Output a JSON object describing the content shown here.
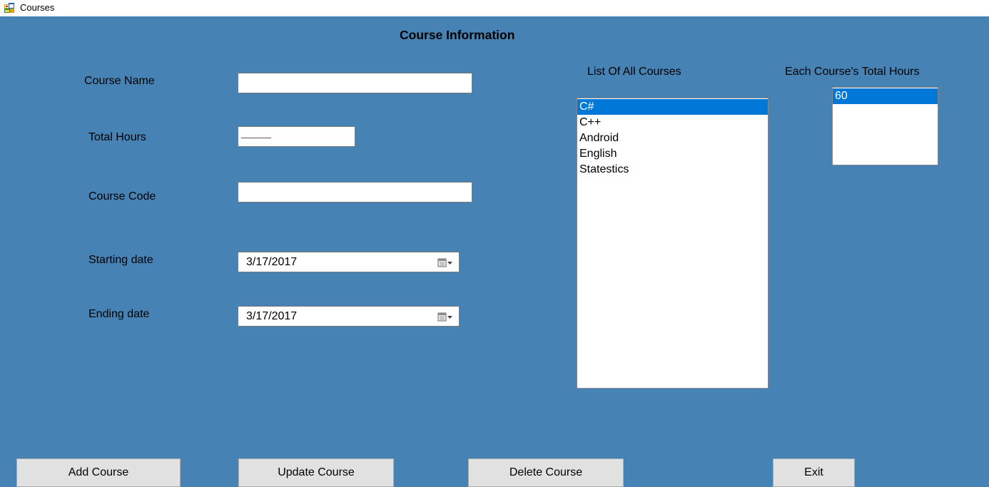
{
  "window": {
    "title": "Courses",
    "icon": "form-app-icon"
  },
  "form": {
    "heading": "Course Information",
    "background": "#4682b4",
    "labels": {
      "course_name": "Course Name",
      "total_hours": "Total Hours",
      "course_code": "Course Code",
      "starting_date": "Starting date",
      "ending_date": "Ending date"
    },
    "inputs": {
      "course_name": "",
      "total_hours_mask": "_____",
      "course_code": "",
      "starting_date": "3/17/2017",
      "ending_date": "3/17/2017"
    },
    "lists": {
      "courses_label": "List Of All Courses",
      "courses": [
        "C#",
        "C++",
        "Android",
        "English",
        "Statestics"
      ],
      "courses_selected": "C#",
      "hours_label": "Each Course's Total Hours",
      "hours": [
        "60"
      ],
      "hours_selected": "60"
    },
    "buttons": {
      "add": "Add Course",
      "update": "Update Course",
      "delete": "Delete Course",
      "exit": "Exit"
    }
  },
  "colors": {
    "selection": "#0078d7",
    "button_face": "#e1e1e1"
  }
}
